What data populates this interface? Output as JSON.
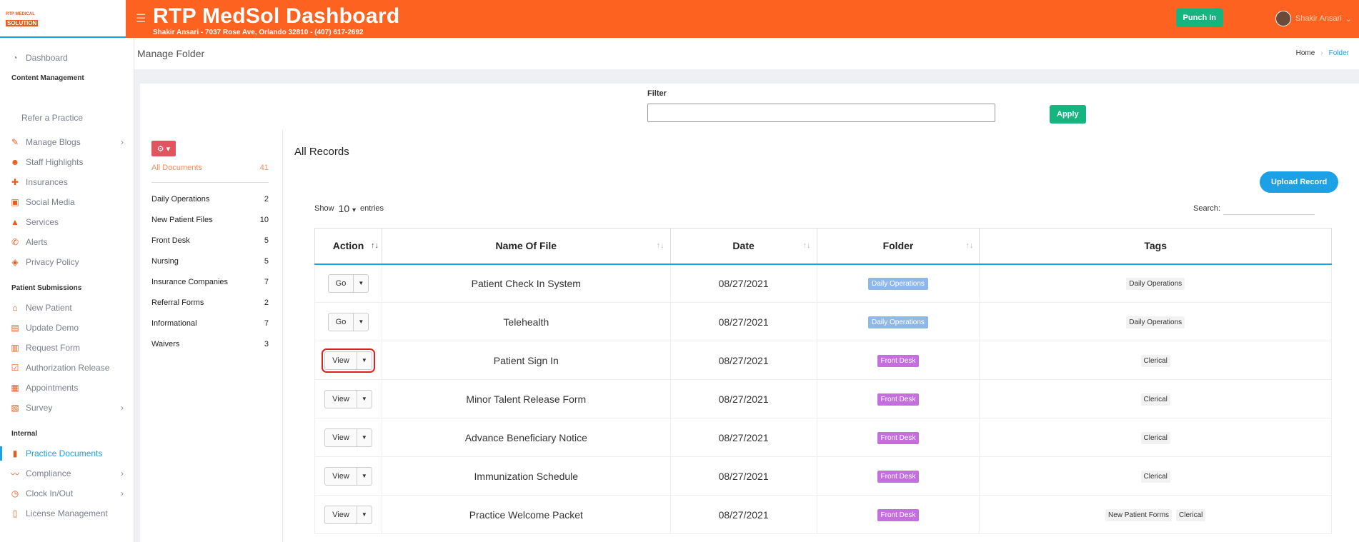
{
  "logo": {
    "top": "RTP MEDICAL",
    "bottom": "SOLUTION"
  },
  "sidebar": {
    "dashboard": "Dashboard",
    "content_head": "Content Management",
    "refer": "Refer a Practice",
    "content_items": [
      {
        "label": "Manage Blogs",
        "icon": "blog-icon",
        "chev": true
      },
      {
        "label": "Staff Highlights",
        "icon": "staff-icon"
      },
      {
        "label": "Insurances",
        "icon": "insurance-icon"
      },
      {
        "label": "Social Media",
        "icon": "social-media-icon"
      },
      {
        "label": "Services",
        "icon": "services-icon"
      },
      {
        "label": "Alerts",
        "icon": "alert-icon"
      },
      {
        "label": "Privacy Policy",
        "icon": "shield-icon"
      }
    ],
    "patient_head": "Patient Submissions",
    "patient_items": [
      {
        "label": "New Patient",
        "icon": "home-icon"
      },
      {
        "label": "Update Demo",
        "icon": "id-card-icon"
      },
      {
        "label": "Request Form",
        "icon": "file-icon"
      },
      {
        "label": "Authorization Release",
        "icon": "check-square-icon"
      },
      {
        "label": "Appointments",
        "icon": "calendar-icon"
      },
      {
        "label": "Survey",
        "icon": "chart-icon",
        "chev": true
      }
    ],
    "internal_head": "Internal",
    "internal_items": [
      {
        "label": "Practice Documents",
        "icon": "clipboard-icon",
        "active": true
      },
      {
        "label": "Compliance",
        "icon": "signature-icon",
        "chev": true
      },
      {
        "label": "Clock In/Out",
        "icon": "clock-icon",
        "chev": true
      },
      {
        "label": "License Management",
        "icon": "license-icon"
      }
    ]
  },
  "topbar": {
    "title": "RTP MedSol Dashboard",
    "address": "Shakir Ansari - 7037 Rose Ave, Orlando 32810 - (407) 617-2692",
    "punch": "Punch In",
    "user": "Shakir Ansari"
  },
  "page": {
    "title": "Manage Folder",
    "crumb_home": "Home",
    "crumb_current": "Folder"
  },
  "filter": {
    "label": "Filter",
    "apply": "Apply"
  },
  "folders": {
    "all_label": "All Documents",
    "all_count": "41",
    "items": [
      {
        "name": "Daily Operations",
        "count": "2"
      },
      {
        "name": "New Patient Files",
        "count": "10"
      },
      {
        "name": "Front Desk",
        "count": "5"
      },
      {
        "name": "Nursing",
        "count": "5"
      },
      {
        "name": "Insurance Companies",
        "count": "7"
      },
      {
        "name": "Referral Forms",
        "count": "2"
      },
      {
        "name": "Informational",
        "count": "7"
      },
      {
        "name": "Waivers",
        "count": "3"
      }
    ]
  },
  "records": {
    "title": "All Records",
    "upload": "Upload Record",
    "show": "Show",
    "entries_value": "10",
    "entries": "entries",
    "search": "Search:",
    "columns": [
      "Action",
      "Name Of File",
      "Date",
      "Folder",
      "Tags"
    ],
    "rows": [
      {
        "action": "Go",
        "name": "Patient Check In System",
        "date": "08/27/2021",
        "folder": "Daily Operations",
        "folder_color": "#8fb8e8",
        "tags": [
          "Daily Operations"
        ]
      },
      {
        "action": "Go",
        "name": "Telehealth",
        "date": "08/27/2021",
        "folder": "Daily Operations",
        "folder_color": "#8fb8e8",
        "tags": [
          "Daily Operations"
        ]
      },
      {
        "action": "View",
        "name": "Patient Sign In",
        "date": "08/27/2021",
        "folder": "Front Desk",
        "folder_color": "#c46ee0",
        "tags": [
          "Clerical"
        ],
        "highlight": true
      },
      {
        "action": "View",
        "name": "Minor Talent Release Form",
        "date": "08/27/2021",
        "folder": "Front Desk",
        "folder_color": "#c46ee0",
        "tags": [
          "Clerical"
        ]
      },
      {
        "action": "View",
        "name": "Advance Beneficiary Notice",
        "date": "08/27/2021",
        "folder": "Front Desk",
        "folder_color": "#c46ee0",
        "tags": [
          "Clerical"
        ]
      },
      {
        "action": "View",
        "name": "Immunization Schedule",
        "date": "08/27/2021",
        "folder": "Front Desk",
        "folder_color": "#c46ee0",
        "tags": [
          "Clerical"
        ]
      },
      {
        "action": "View",
        "name": "Practice Welcome Packet",
        "date": "08/27/2021",
        "folder": "Front Desk",
        "folder_color": "#c46ee0",
        "tags": [
          "New Patient Forms",
          "Clerical"
        ]
      }
    ]
  }
}
